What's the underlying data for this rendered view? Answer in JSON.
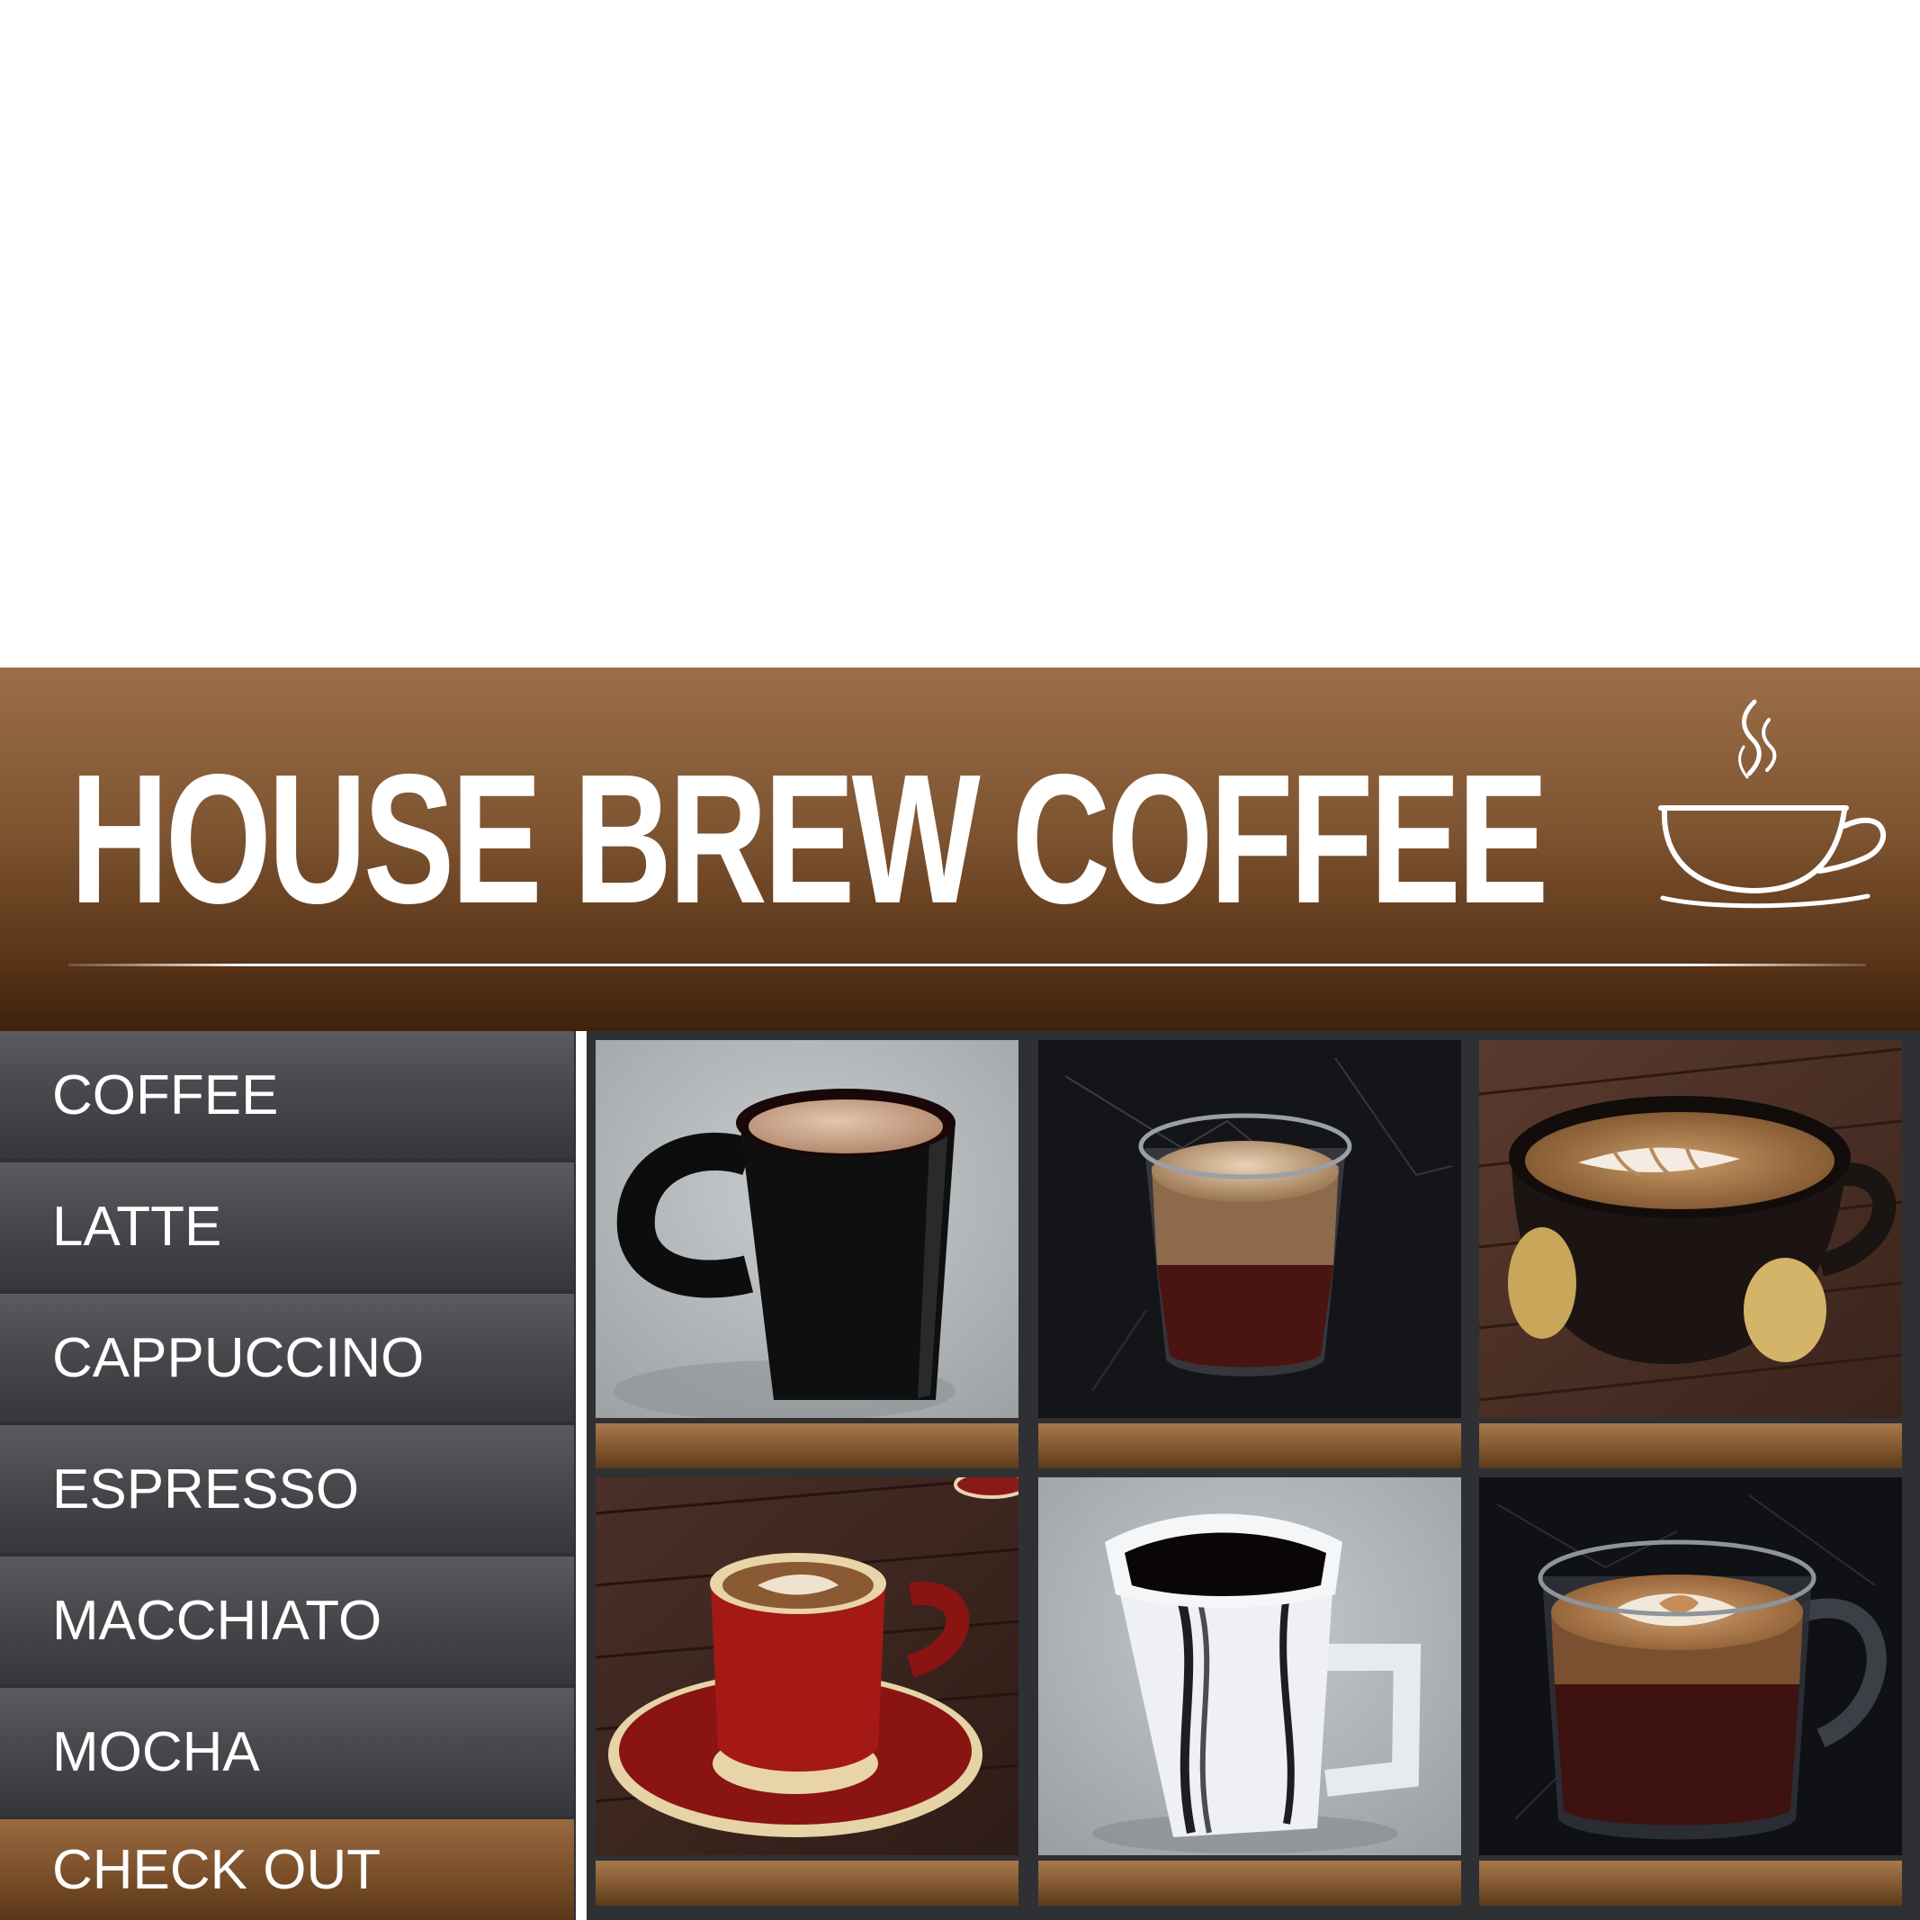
{
  "header": {
    "title": "HOUSE BREW COFFEE",
    "logo_icon": "steaming-coffee-cup-icon"
  },
  "menu": {
    "items": [
      {
        "label": "COFFEE"
      },
      {
        "label": "LATTE"
      },
      {
        "label": "CAPPUCCINO"
      },
      {
        "label": "ESPRESSO"
      },
      {
        "label": "MACCHIATO"
      },
      {
        "label": "MOCHA"
      }
    ],
    "checkout_label": "CHECK OUT"
  },
  "products": [
    {
      "image": "black-mug-on-concrete"
    },
    {
      "image": "glass-cappuccino-on-black-marble"
    },
    {
      "image": "latte-art-cup-with-gold-dots-on-wood"
    },
    {
      "image": "red-cup-on-saucer-on-wood"
    },
    {
      "image": "white-striped-mug-on-concrete"
    },
    {
      "image": "glass-latte-art-mug-on-black-marble"
    }
  ],
  "colors": {
    "brand_brown": "#7e5431",
    "menu_gray": "#48494d",
    "text": "#ffffff"
  }
}
